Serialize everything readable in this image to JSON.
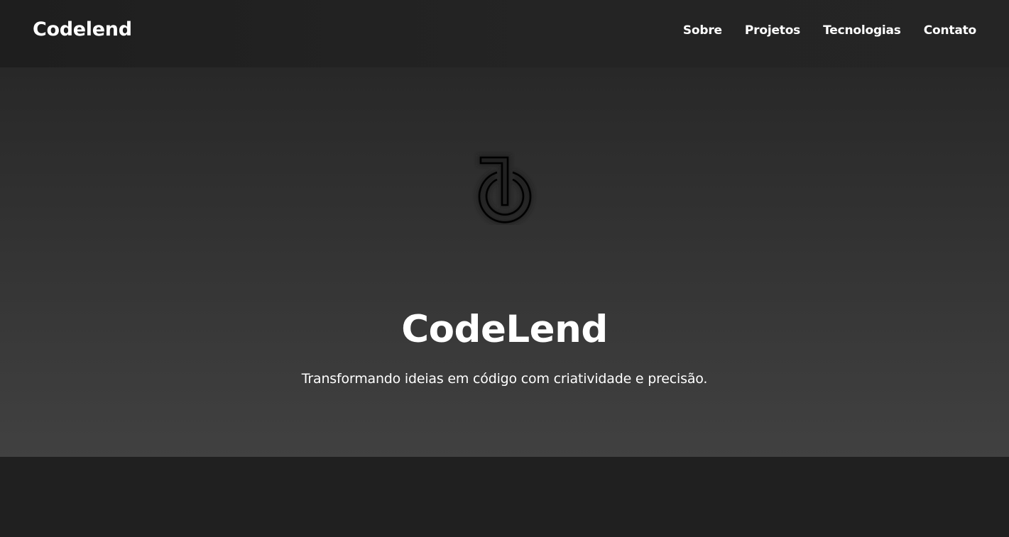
{
  "navbar": {
    "brand": "Codelend",
    "links": [
      {
        "label": "Sobre"
      },
      {
        "label": "Projetos"
      },
      {
        "label": "Tecnologias"
      },
      {
        "label": "Contato"
      }
    ]
  },
  "hero": {
    "logo_icon": "codelend-logo-icon",
    "title": "CodeLend",
    "subtitle": "Transformando ideias em código com criatividade e precisão."
  },
  "colors": {
    "navbar_bg": "#1f1f1f",
    "hero_bg_top": "#282828",
    "hero_bg_bottom": "#414141",
    "page_bg": "#202020",
    "text": "#ffffff",
    "logo_stroke": "#000000"
  }
}
